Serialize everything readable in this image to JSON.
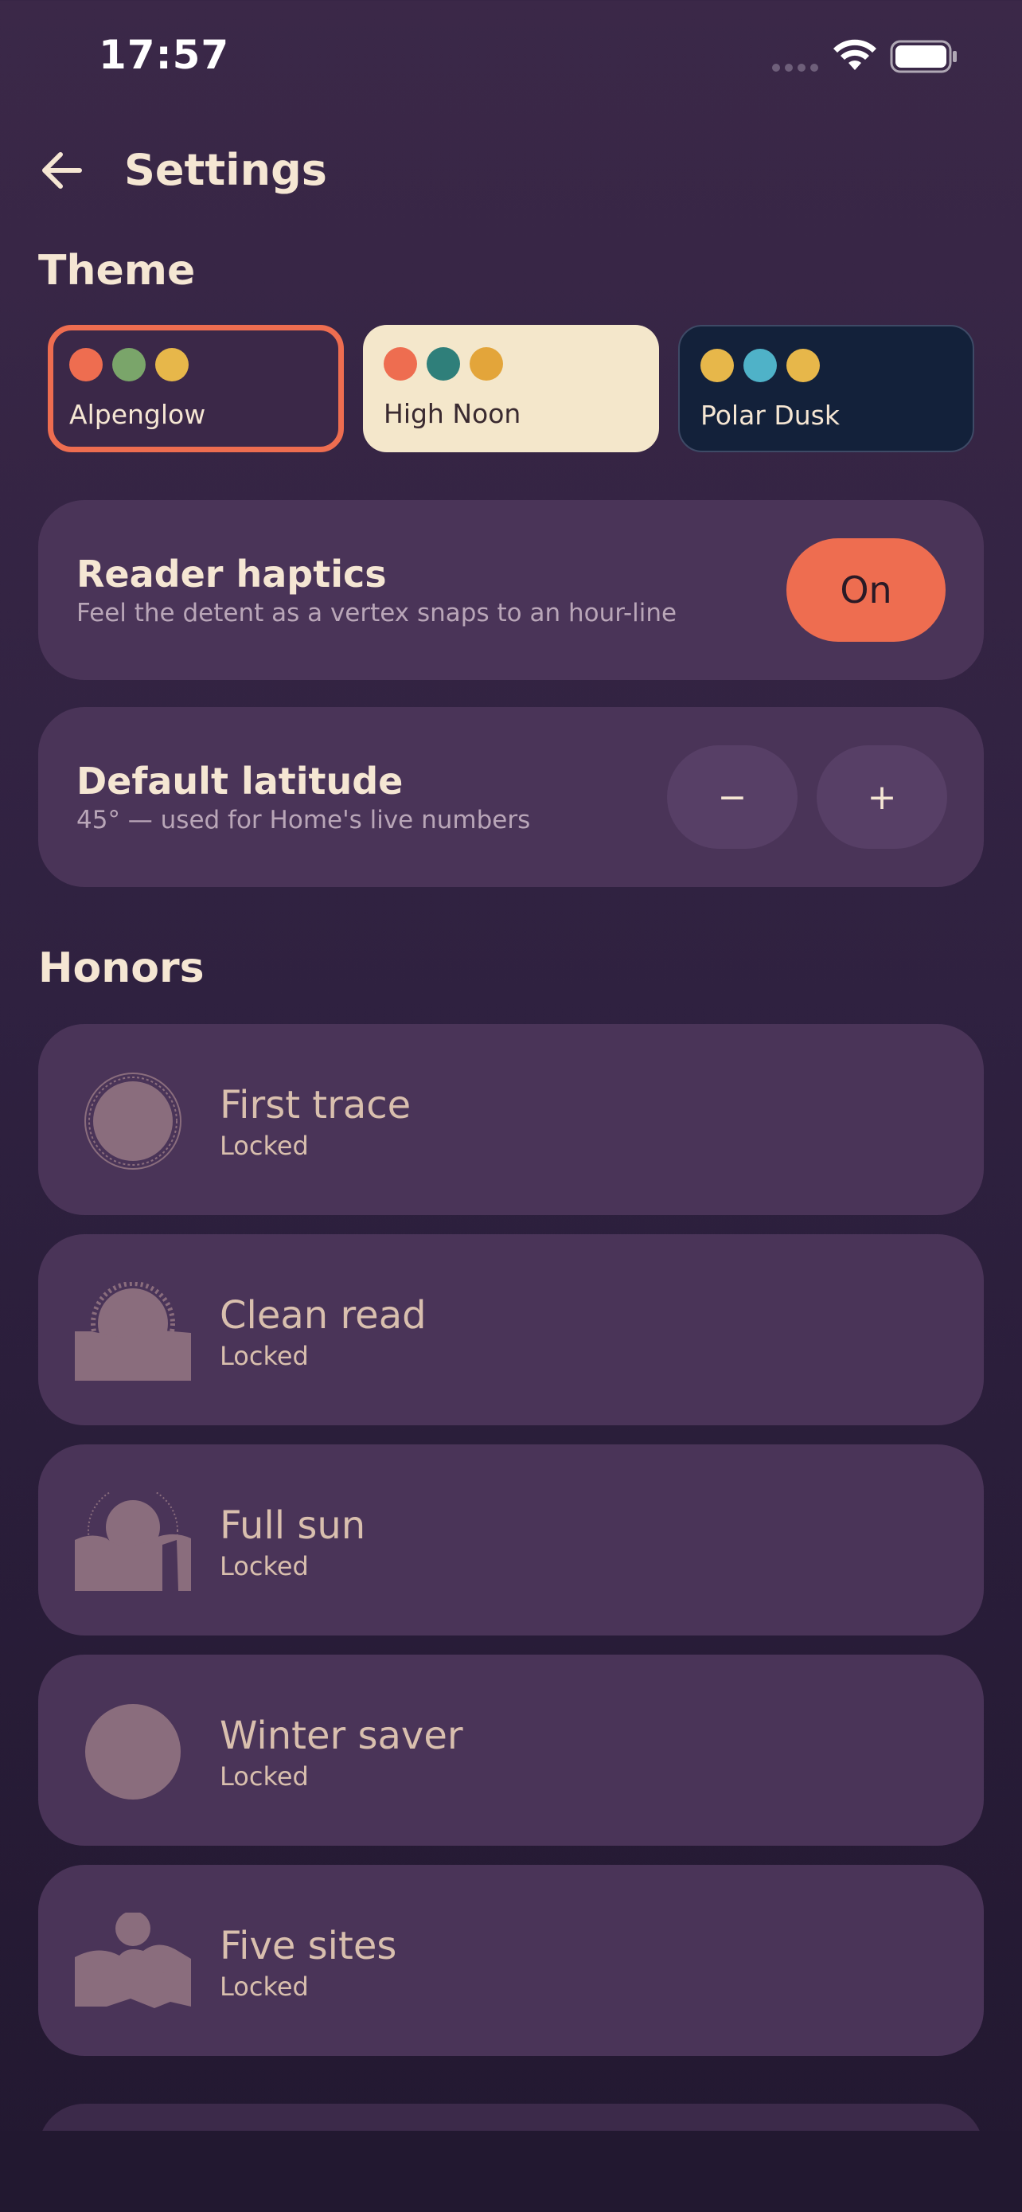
{
  "status_bar": {
    "time": "17:57"
  },
  "header": {
    "title": "Settings"
  },
  "theme": {
    "section_title": "Theme",
    "options": [
      {
        "label": "Alpenglow",
        "selected": true,
        "colors": [
          "#ee6d50",
          "#7aa56a",
          "#e7b74a"
        ]
      },
      {
        "label": "High Noon",
        "selected": false,
        "colors": [
          "#ee6d50",
          "#2f7f7a",
          "#e3a53a"
        ]
      },
      {
        "label": "Polar Dusk",
        "selected": false,
        "colors": [
          "#e7b74a",
          "#4fb2c8",
          "#e7b74a"
        ]
      }
    ]
  },
  "reader_haptics": {
    "title": "Reader haptics",
    "subtitle": "Feel the detent as a vertex snaps to an hour-line",
    "toggle_label": "On"
  },
  "default_latitude": {
    "title": "Default latitude",
    "subtitle": "45° — used for Home's live numbers",
    "decrement_label": "−",
    "increment_label": "+"
  },
  "honors": {
    "section_title": "Honors",
    "items": [
      {
        "name": "First trace",
        "status": "Locked",
        "badge": "circle-dial-badge-icon"
      },
      {
        "name": "Clean read",
        "status": "Locked",
        "badge": "sun-rise-badge-icon"
      },
      {
        "name": "Full sun",
        "status": "Locked",
        "badge": "full-sun-badge-icon"
      },
      {
        "name": "Winter saver",
        "status": "Locked",
        "badge": "disc-badge-icon"
      },
      {
        "name": "Five sites",
        "status": "Locked",
        "badge": "sites-badge-icon"
      }
    ]
  },
  "colors": {
    "accent": "#ee6d50",
    "card": "#4a3458",
    "text": "#f5e6d3",
    "badge": "#8a6d7d"
  }
}
